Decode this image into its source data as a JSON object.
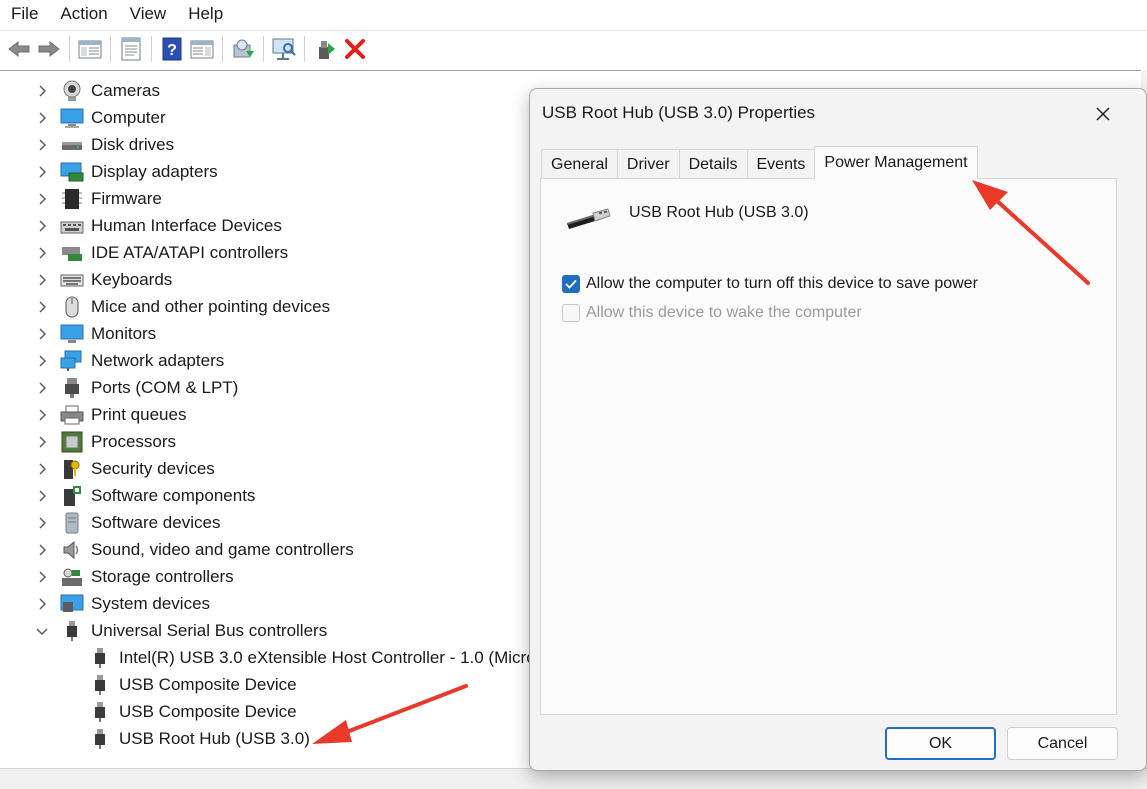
{
  "menu": {
    "file": "File",
    "action": "Action",
    "view": "View",
    "help": "Help"
  },
  "toolbar": {
    "icons": [
      "back-icon",
      "forward-icon",
      "show-hide-console-tree-icon",
      "properties-icon",
      "help-icon",
      "show-action-pane-icon",
      "update-driver-icon",
      "scan-hardware-icon",
      "enable-device-icon",
      "uninstall-device-icon"
    ],
    "uninstall_color": "#e0201b"
  },
  "tree": {
    "categories": [
      {
        "label": "Cameras",
        "icon": "camera-icon"
      },
      {
        "label": "Computer",
        "icon": "computer-icon"
      },
      {
        "label": "Disk drives",
        "icon": "disk-drive-icon"
      },
      {
        "label": "Display adapters",
        "icon": "display-adapter-icon"
      },
      {
        "label": "Firmware",
        "icon": "firmware-icon"
      },
      {
        "label": "Human Interface Devices",
        "icon": "hid-icon"
      },
      {
        "label": "IDE ATA/ATAPI controllers",
        "icon": "ide-controller-icon"
      },
      {
        "label": "Keyboards",
        "icon": "keyboard-icon"
      },
      {
        "label": "Mice and other pointing devices",
        "icon": "mouse-icon"
      },
      {
        "label": "Monitors",
        "icon": "monitor-icon"
      },
      {
        "label": "Network adapters",
        "icon": "network-adapter-icon"
      },
      {
        "label": "Ports (COM & LPT)",
        "icon": "port-icon"
      },
      {
        "label": "Print queues",
        "icon": "printer-icon"
      },
      {
        "label": "Processors",
        "icon": "processor-icon"
      },
      {
        "label": "Security devices",
        "icon": "security-device-icon"
      },
      {
        "label": "Software components",
        "icon": "software-component-icon"
      },
      {
        "label": "Software devices",
        "icon": "software-device-icon"
      },
      {
        "label": "Sound, video and game controllers",
        "icon": "sound-icon"
      },
      {
        "label": "Storage controllers",
        "icon": "storage-controller-icon"
      },
      {
        "label": "System devices",
        "icon": "system-device-icon"
      }
    ],
    "usb": {
      "label": "Universal Serial Bus controllers",
      "expanded": true,
      "children": [
        "Intel(R) USB 3.0 eXtensible Host Controller - 1.0 (Micro",
        "USB Composite Device",
        "USB Composite Device",
        "USB Root Hub (USB 3.0)"
      ]
    }
  },
  "dialog": {
    "title": "USB Root Hub (USB 3.0) Properties",
    "tabs": [
      "General",
      "Driver",
      "Details",
      "Events",
      "Power Management"
    ],
    "active_tab": "Power Management",
    "device_name": "USB Root Hub (USB 3.0)",
    "options": [
      {
        "label": "Allow the computer to turn off this device to save power",
        "checked": true,
        "enabled": true
      },
      {
        "label": "Allow this device to wake the computer",
        "checked": false,
        "enabled": false
      }
    ],
    "ok_label": "OK",
    "cancel_label": "Cancel"
  },
  "colors": {
    "accent": "#1f6fbf",
    "annotation_arrow": "#e8392b"
  }
}
